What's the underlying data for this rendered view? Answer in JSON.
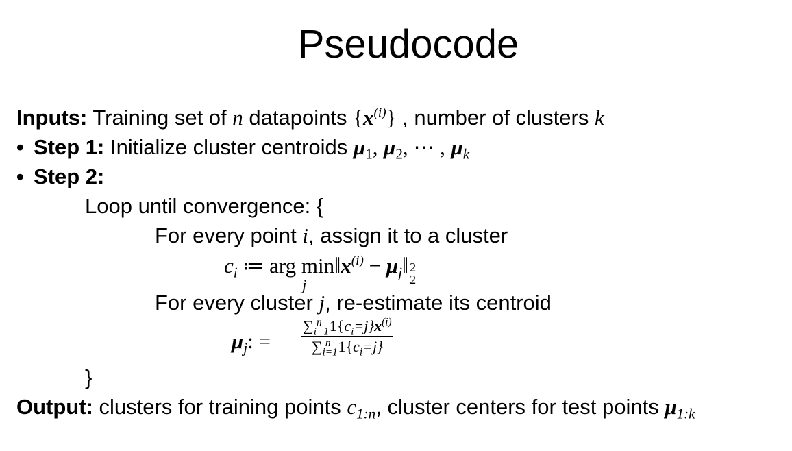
{
  "title": "Pseudocode",
  "inputs": {
    "label": "Inputs:",
    "text_a": "Training set of",
    "n": "n",
    "text_b": "datapoints",
    "set_open": "{",
    "x": "x",
    "sup_i": "(i)",
    "set_close": "}",
    "text_c": ", number of clusters",
    "k": "k"
  },
  "step1": {
    "bullet": "•",
    "label": "Step 1:",
    "text": "Initialize cluster centroids",
    "mu": "μ",
    "s1": "1",
    "comma1": ",",
    "s2": "2",
    "comma2": ", ⋯ ,",
    "sk": "k"
  },
  "step2": {
    "bullet": "•",
    "label": "Step 2:"
  },
  "loop": {
    "open": "Loop until convergence: {",
    "close": "}"
  },
  "assign": {
    "text_a": "For every point",
    "i": "i",
    "text_b": ", assign it to a cluster",
    "c": "c",
    "ci_sub": "i",
    "assign_op": "≔",
    "argmin": "arg min",
    "argmin_sub": "j",
    "norm_open": "‖",
    "x": "x",
    "sup_i": "(i)",
    "minus": "−",
    "mu": "μ",
    "mu_sub": "j",
    "norm_close": "‖",
    "pow": "2",
    "norm_sub": "2"
  },
  "update": {
    "text_a": "For every cluster",
    "j": "j",
    "text_b": ", re-estimate its centroid",
    "mu": "μ",
    "mu_sub": "j",
    "assign_op": ": =",
    "sum": "∑",
    "sum_sub": "i=1",
    "sum_sup": "n",
    "indicator_num": "1{",
    "c": "c",
    "c_sub": "i",
    "eq_j": "=j}",
    "x": "x",
    "x_sup": "(i)",
    "indicator_den": "1{",
    "den_eq_j": "=j}"
  },
  "output": {
    "label": "Output:",
    "text_a": "clusters for training points",
    "c": "c",
    "c_sub": "1:n",
    "text_b": ", cluster centers for test points",
    "mu": "μ",
    "mu_sub": "1:k"
  }
}
